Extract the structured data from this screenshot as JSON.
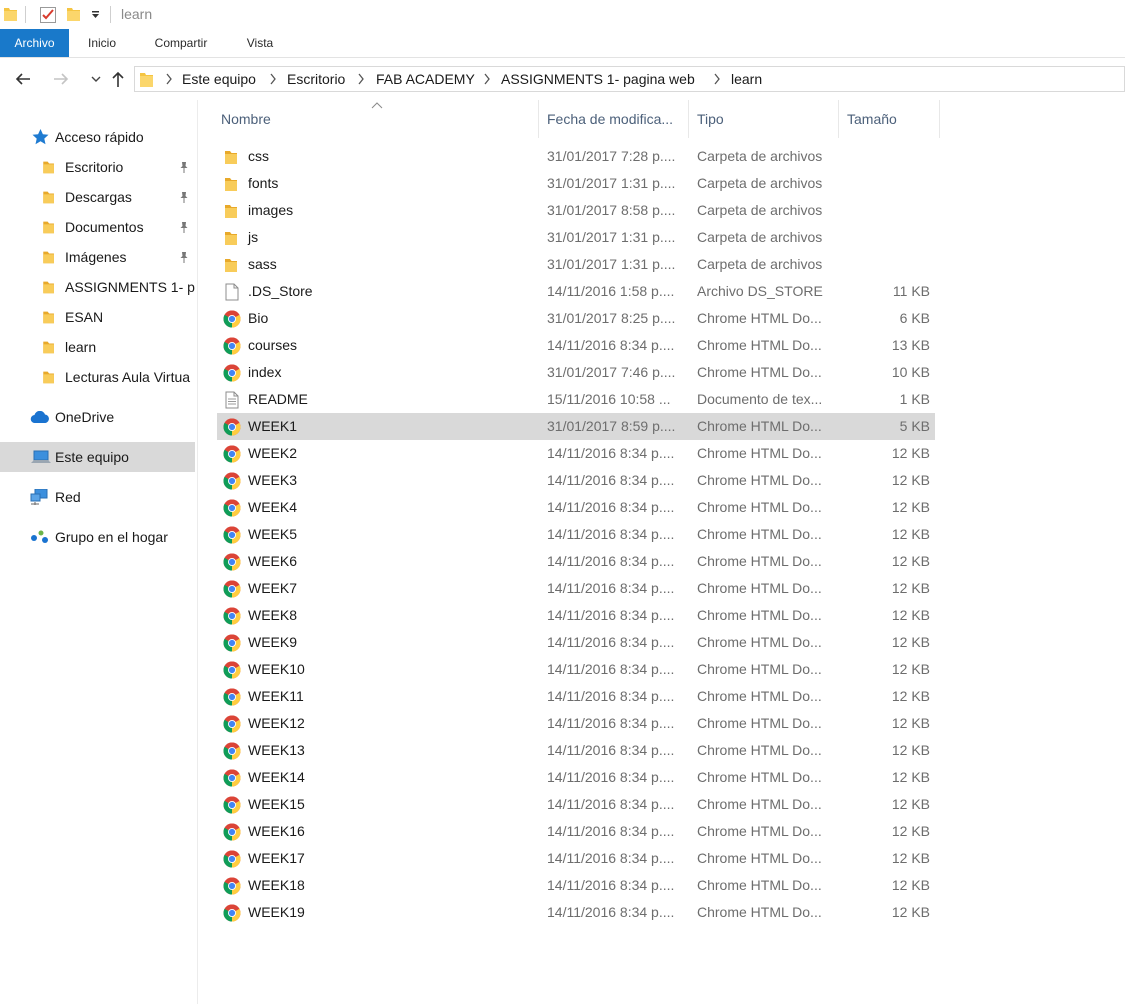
{
  "window": {
    "title": "learn"
  },
  "ribbon": {
    "tabs": [
      "Archivo",
      "Inicio",
      "Compartir",
      "Vista"
    ]
  },
  "breadcrumb": [
    "Este equipo",
    "Escritorio",
    "FAB ACADEMY",
    "ASSIGNMENTS 1-  pagina web",
    "learn"
  ],
  "nav": {
    "quick_access": "Acceso rápido",
    "items": [
      {
        "label": "Escritorio",
        "pinned": true
      },
      {
        "label": "Descargas",
        "pinned": true
      },
      {
        "label": "Documentos",
        "pinned": true
      },
      {
        "label": "Imágenes",
        "pinned": true
      },
      {
        "label": "ASSIGNMENTS 1-  p",
        "pinned": false
      },
      {
        "label": "ESAN",
        "pinned": false
      },
      {
        "label": "learn",
        "pinned": false
      },
      {
        "label": "Lecturas Aula Virtua",
        "pinned": false
      }
    ],
    "onedrive": "OneDrive",
    "this_pc": "Este equipo",
    "network": "Red",
    "homegroup": "Grupo en el hogar"
  },
  "columns": {
    "name": "Nombre",
    "date": "Fecha de modifica...",
    "type": "Tipo",
    "size": "Tamaño"
  },
  "files": [
    {
      "name": "css",
      "date": "31/01/2017 7:28 p....",
      "type": "Carpeta de archivos",
      "size": "",
      "icon": "folder"
    },
    {
      "name": "fonts",
      "date": "31/01/2017 1:31 p....",
      "type": "Carpeta de archivos",
      "size": "",
      "icon": "folder"
    },
    {
      "name": "images",
      "date": "31/01/2017 8:58 p....",
      "type": "Carpeta de archivos",
      "size": "",
      "icon": "folder"
    },
    {
      "name": "js",
      "date": "31/01/2017 1:31 p....",
      "type": "Carpeta de archivos",
      "size": "",
      "icon": "folder"
    },
    {
      "name": "sass",
      "date": "31/01/2017 1:31 p....",
      "type": "Carpeta de archivos",
      "size": "",
      "icon": "folder"
    },
    {
      "name": ".DS_Store",
      "date": "14/11/2016 1:58 p....",
      "type": "Archivo DS_STORE",
      "size": "11 KB",
      "icon": "file"
    },
    {
      "name": "Bio",
      "date": "31/01/2017 8:25 p....",
      "type": "Chrome HTML Do...",
      "size": "6 KB",
      "icon": "chrome"
    },
    {
      "name": "courses",
      "date": "14/11/2016 8:34 p....",
      "type": "Chrome HTML Do...",
      "size": "13 KB",
      "icon": "chrome"
    },
    {
      "name": "index",
      "date": "31/01/2017 7:46 p....",
      "type": "Chrome HTML Do...",
      "size": "10 KB",
      "icon": "chrome"
    },
    {
      "name": "README",
      "date": "15/11/2016 10:58 ...",
      "type": "Documento de tex...",
      "size": "1 KB",
      "icon": "text"
    },
    {
      "name": "WEEK1",
      "date": "31/01/2017 8:59 p....",
      "type": "Chrome HTML Do...",
      "size": "5 KB",
      "icon": "chrome",
      "selected": true
    },
    {
      "name": "WEEK2",
      "date": "14/11/2016 8:34 p....",
      "type": "Chrome HTML Do...",
      "size": "12 KB",
      "icon": "chrome"
    },
    {
      "name": "WEEK3",
      "date": "14/11/2016 8:34 p....",
      "type": "Chrome HTML Do...",
      "size": "12 KB",
      "icon": "chrome"
    },
    {
      "name": "WEEK4",
      "date": "14/11/2016 8:34 p....",
      "type": "Chrome HTML Do...",
      "size": "12 KB",
      "icon": "chrome"
    },
    {
      "name": "WEEK5",
      "date": "14/11/2016 8:34 p....",
      "type": "Chrome HTML Do...",
      "size": "12 KB",
      "icon": "chrome"
    },
    {
      "name": "WEEK6",
      "date": "14/11/2016 8:34 p....",
      "type": "Chrome HTML Do...",
      "size": "12 KB",
      "icon": "chrome"
    },
    {
      "name": "WEEK7",
      "date": "14/11/2016 8:34 p....",
      "type": "Chrome HTML Do...",
      "size": "12 KB",
      "icon": "chrome"
    },
    {
      "name": "WEEK8",
      "date": "14/11/2016 8:34 p....",
      "type": "Chrome HTML Do...",
      "size": "12 KB",
      "icon": "chrome"
    },
    {
      "name": "WEEK9",
      "date": "14/11/2016 8:34 p....",
      "type": "Chrome HTML Do...",
      "size": "12 KB",
      "icon": "chrome"
    },
    {
      "name": "WEEK10",
      "date": "14/11/2016 8:34 p....",
      "type": "Chrome HTML Do...",
      "size": "12 KB",
      "icon": "chrome"
    },
    {
      "name": "WEEK11",
      "date": "14/11/2016 8:34 p....",
      "type": "Chrome HTML Do...",
      "size": "12 KB",
      "icon": "chrome"
    },
    {
      "name": "WEEK12",
      "date": "14/11/2016 8:34 p....",
      "type": "Chrome HTML Do...",
      "size": "12 KB",
      "icon": "chrome"
    },
    {
      "name": "WEEK13",
      "date": "14/11/2016 8:34 p....",
      "type": "Chrome HTML Do...",
      "size": "12 KB",
      "icon": "chrome"
    },
    {
      "name": "WEEK14",
      "date": "14/11/2016 8:34 p....",
      "type": "Chrome HTML Do...",
      "size": "12 KB",
      "icon": "chrome"
    },
    {
      "name": "WEEK15",
      "date": "14/11/2016 8:34 p....",
      "type": "Chrome HTML Do...",
      "size": "12 KB",
      "icon": "chrome"
    },
    {
      "name": "WEEK16",
      "date": "14/11/2016 8:34 p....",
      "type": "Chrome HTML Do...",
      "size": "12 KB",
      "icon": "chrome"
    },
    {
      "name": "WEEK17",
      "date": "14/11/2016 8:34 p....",
      "type": "Chrome HTML Do...",
      "size": "12 KB",
      "icon": "chrome"
    },
    {
      "name": "WEEK18",
      "date": "14/11/2016 8:34 p....",
      "type": "Chrome HTML Do...",
      "size": "12 KB",
      "icon": "chrome"
    },
    {
      "name": "WEEK19",
      "date": "14/11/2016 8:34 p....",
      "type": "Chrome HTML Do...",
      "size": "12 KB",
      "icon": "chrome"
    }
  ],
  "colors": {
    "accent": "#1979ca",
    "selection": "#d9d9d9",
    "folder": "#f5c542",
    "header_text": "#4c607a"
  }
}
